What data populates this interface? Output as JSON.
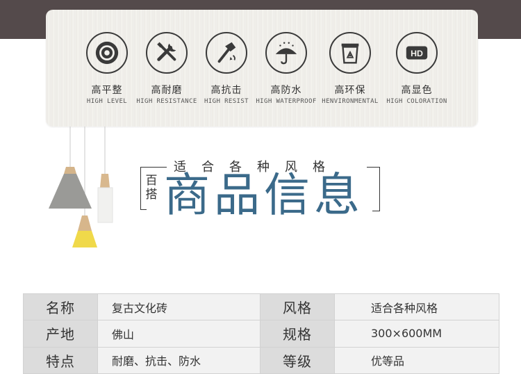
{
  "features": [
    {
      "icon": "disc-icon",
      "zh": "高平整",
      "en": "HIGH LEVEL"
    },
    {
      "icon": "tools-icon",
      "zh": "高耐磨",
      "en": "HIGH RESISTANCE"
    },
    {
      "icon": "hammer-icon",
      "zh": "高抗击",
      "en": "HIGH RESIST"
    },
    {
      "icon": "umbrella-icon",
      "zh": "高防水",
      "en": "HIGH WATERPROOF"
    },
    {
      "icon": "recycle-icon",
      "zh": "高环保",
      "en": "HENVIRONMENTAL"
    },
    {
      "icon": "hd-icon",
      "zh": "高显色",
      "en": "HIGH COLORATION",
      "badge": "HD"
    }
  ],
  "heading": {
    "subtitle": "适合各种风格",
    "side_top": "百",
    "side_bottom": "搭",
    "title": "商品信息"
  },
  "info": {
    "rows": [
      {
        "k1": "名称",
        "v1": "复古文化砖",
        "k2": "风格",
        "v2": "适合各种风格"
      },
      {
        "k1": "产地",
        "v1": "佛山",
        "k2": "规格",
        "v2": "300×600MM"
      },
      {
        "k1": "特点",
        "v1": "耐磨、抗击、防水",
        "k2": "等级",
        "v2": "优等品"
      }
    ]
  },
  "colors": {
    "top_band": "#544a4b",
    "title_blue": "#3b6a8a",
    "key_cell": "#dcdcdc",
    "value_cell": "#f2f2f2"
  }
}
